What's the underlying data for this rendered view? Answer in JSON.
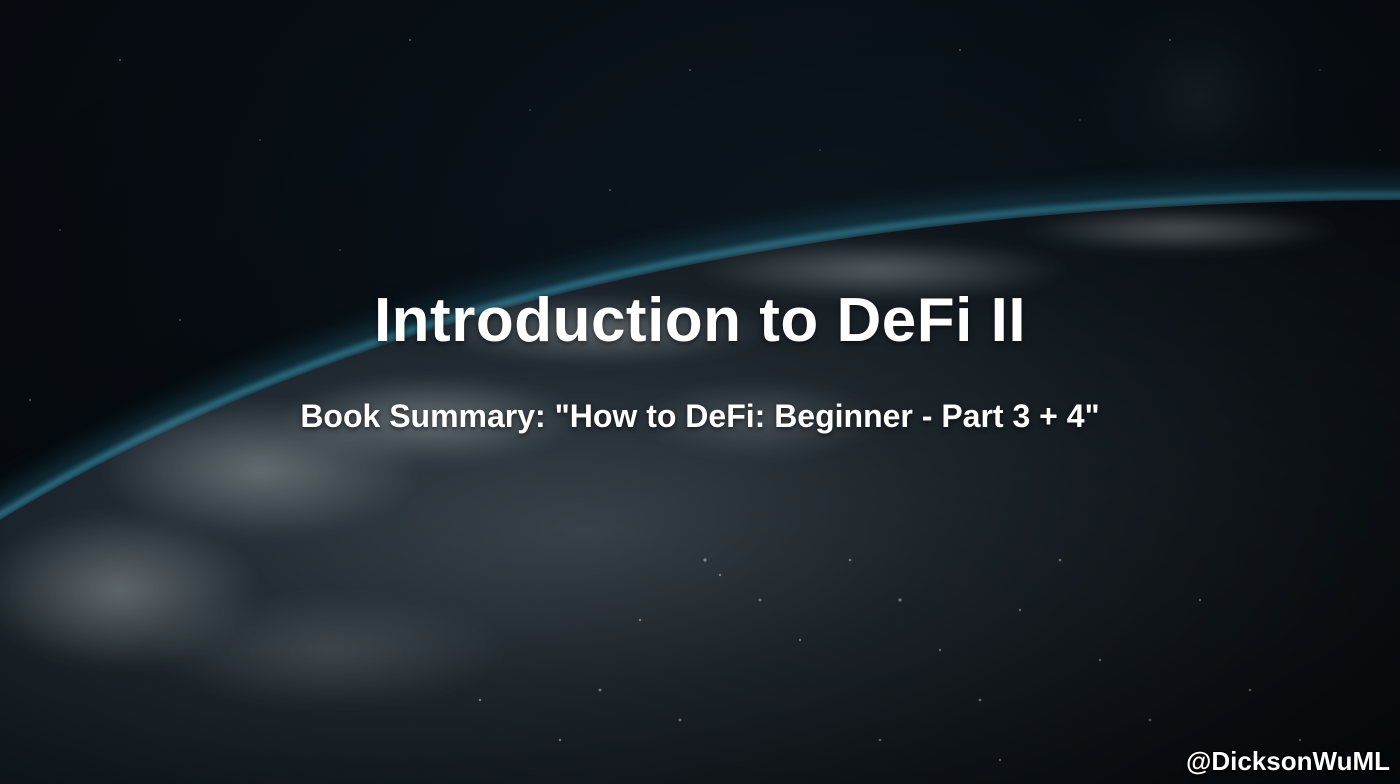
{
  "slide": {
    "title": "Introduction to DeFi II",
    "subtitle": "Book Summary: \"How to DeFi: Beginner - Part 3 + 4\"",
    "handle": "@DicksonWuML"
  },
  "background": {
    "description_icon": "earth-from-space-image",
    "atmosphere_color": "#2f8aa6",
    "space_color": "#05090d"
  }
}
